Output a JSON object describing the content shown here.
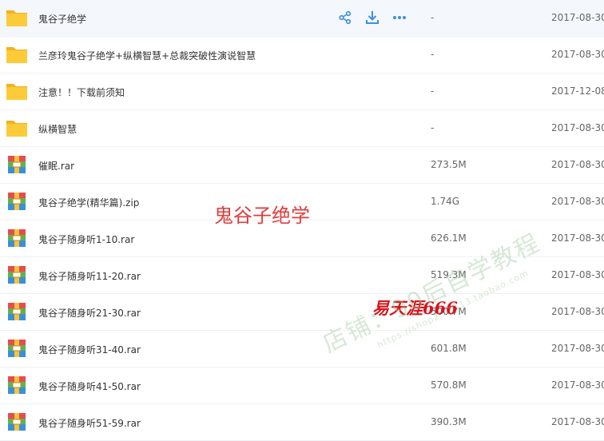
{
  "files": [
    {
      "name": "鬼谷子绝学",
      "type": "folder",
      "size": "-",
      "date": "2017-08-30",
      "hovered": true
    },
    {
      "name": "兰彦玲鬼谷子绝学+纵横智慧+总裁突破性演说智慧",
      "type": "folder",
      "size": "-",
      "date": "2017-08-30"
    },
    {
      "name": "注意！！下载前须知",
      "type": "folder",
      "size": "-",
      "date": "2017-12-08"
    },
    {
      "name": "纵横智慧",
      "type": "folder",
      "size": "-",
      "date": "2017-08-30"
    },
    {
      "name": "催眠.rar",
      "type": "archive",
      "size": "273.5M",
      "date": "2017-08-30"
    },
    {
      "name": "鬼谷子绝学(精华篇).zip",
      "type": "archive",
      "size": "1.74G",
      "date": "2017-08-30"
    },
    {
      "name": "鬼谷子随身听1-10.rar",
      "type": "archive",
      "size": "626.1M",
      "date": "2017-08-30"
    },
    {
      "name": "鬼谷子随身听11-20.rar",
      "type": "archive",
      "size": "519.3M",
      "date": "2017-08-30"
    },
    {
      "name": "鬼谷子随身听21-30.rar",
      "type": "archive",
      "size": "500.7M",
      "date": "2017-08-30"
    },
    {
      "name": "鬼谷子随身听31-40.rar",
      "type": "archive",
      "size": "601.8M",
      "date": "2017-08-30"
    },
    {
      "name": "鬼谷子随身听41-50.rar",
      "type": "archive",
      "size": "570.8M",
      "date": "2017-08-30"
    },
    {
      "name": "鬼谷子随身听51-59.rar",
      "type": "archive",
      "size": "390.3M",
      "date": "2017-08-30"
    }
  ],
  "row_actions": [
    {
      "name": "share-icon",
      "label": "share"
    },
    {
      "name": "download-icon",
      "label": "download"
    },
    {
      "name": "more-icon",
      "label": "more"
    }
  ],
  "overlays": {
    "caption": "鬼谷子绝学",
    "brand": "易天涯666",
    "watermark_line1": "店铺：90后自学教程",
    "watermark_line2": "https://shop2…1113.taobao.com"
  },
  "colors": {
    "folder": "#f9c530",
    "action_icon": "#3b8fe0",
    "hover_row": "#f4f8fd",
    "caption": "#e23b3b",
    "brand": "#d9141b"
  }
}
